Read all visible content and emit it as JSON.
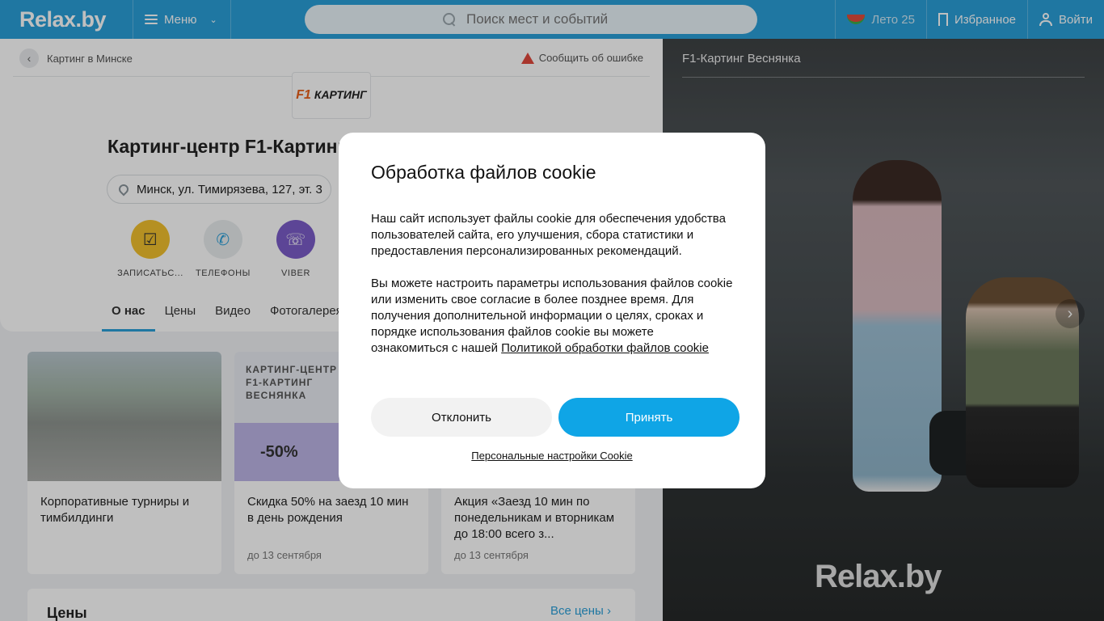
{
  "header": {
    "logo": "Relax.by",
    "menu_label": "Меню",
    "search_placeholder": "Поиск мест и событий",
    "summer_label": "Лето 25",
    "favorites_label": "Избранное",
    "login_label": "Войти",
    "brand_color": "#2a9fd8"
  },
  "breadcrumb": {
    "back_label": "Картинг в Минске",
    "report_label": "Сообщить об ошибке"
  },
  "venue": {
    "logo_text_f1": "F1",
    "logo_text": "КАРТИНГ",
    "title": "Картинг-центр F1-Картинг",
    "address": "Минск, ул. Тимирязева, 127, эт. 3",
    "actions": [
      {
        "label": "ЗАПИСАТЬС...",
        "icon": "calendar-icon",
        "color": "#f2c12e"
      },
      {
        "label": "ТЕЛЕФОНЫ",
        "icon": "phone-icon",
        "color": "#e9ecee"
      },
      {
        "label": "VIBER",
        "icon": "viber-icon",
        "color": "#7b5cc9"
      }
    ]
  },
  "tabs": [
    "О нас",
    "Цены",
    "Видео",
    "Фотогалерея"
  ],
  "cards": [
    {
      "text": "Корпоративные турниры и тимбилдинги",
      "date": ""
    },
    {
      "promo_title": "КАРТИНГ-ЦЕНТР F1-КАРТИНГ ВЕСНЯНКА",
      "promo_discount": "-50%",
      "text": "Скидка 50% на заезд 10 мин в день рождения",
      "date": "до 13 сентября"
    },
    {
      "text": "Акция «Заезд 10 мин по понедельникам и вторникам до 18:00 всего з...",
      "date": "до 13 сентября"
    }
  ],
  "prices": {
    "title": "Цены",
    "all_link": "Все цены"
  },
  "photo": {
    "title": "F1-Картинг Веснянка",
    "watermark": "Relax.by"
  },
  "cookie_dialog": {
    "title": "Обработка файлов cookie",
    "paragraph1": "Наш сайт использует файлы cookie для обеспечения удобства пользователей сайта, его улучшения, сбора статистики и предоставления персонализированных рекомендаций.",
    "paragraph2": "Вы можете настроить параметры использования файлов cookie или изменить свое согласие в более позднее время. Для получения дополнительной информации о целях, сроках и порядке использования файлов cookie вы можете ознакомиться с нашей",
    "policy_link": "Политикой обработки файлов cookie",
    "decline_label": "Отклонить",
    "accept_label": "Принять",
    "settings_link": "Персональные настройки Cookie",
    "accept_color": "#0fa5e6"
  }
}
